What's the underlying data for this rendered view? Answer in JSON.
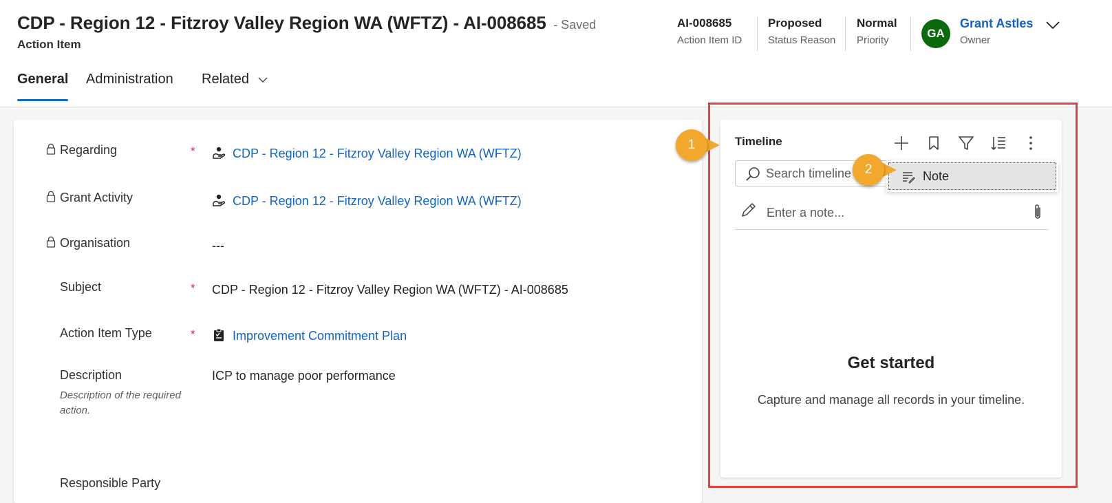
{
  "header": {
    "title": "CDP - Region 12 - Fitzroy Valley Region WA (WFTZ) - AI-008685",
    "save_status": "- Saved",
    "entity": "Action Item",
    "fields": [
      {
        "value": "AI-008685",
        "label": "Action Item ID"
      },
      {
        "value": "Proposed",
        "label": "Status Reason"
      },
      {
        "value": "Normal",
        "label": "Priority"
      }
    ],
    "owner": {
      "initials": "GA",
      "name": "Grant Astles",
      "label": "Owner",
      "avatar_color": "#0b6a0b"
    }
  },
  "tabs": [
    {
      "label": "General",
      "active": true
    },
    {
      "label": "Administration",
      "active": false
    },
    {
      "label": "Related",
      "active": false
    }
  ],
  "form": {
    "regarding": {
      "label": "Regarding",
      "required": "*",
      "value": "CDP - Region 12 - Fitzroy Valley Region WA (WFTZ)"
    },
    "grant_activity": {
      "label": "Grant Activity",
      "value": "CDP - Region 12 - Fitzroy Valley Region WA (WFTZ)"
    },
    "organisation": {
      "label": "Organisation",
      "value": "---"
    },
    "subject": {
      "label": "Subject",
      "required": "*",
      "value": "CDP - Region 12 - Fitzroy Valley Region WA (WFTZ) - AI-008685"
    },
    "action_item_type": {
      "label": "Action Item Type",
      "required": "*",
      "value": "Improvement Commitment Plan"
    },
    "description": {
      "label": "Description",
      "hint": "Description of the required action.",
      "value": "ICP to manage poor performance"
    },
    "responsible_party": {
      "label": "Responsible Party"
    }
  },
  "timeline": {
    "title": "Timeline",
    "search_placeholder": "Search timeline",
    "menu_item": "Note",
    "note_placeholder": "Enter a note...",
    "empty_title": "Get started",
    "empty_desc": "Capture and manage all records in your timeline."
  },
  "annotations": {
    "step1": "1",
    "step2": "2",
    "callout_color": "#f2a72d",
    "highlight_color": "#e0433f"
  },
  "colors": {
    "link": "#1364c7",
    "accent": "#0f6cbd",
    "required": "#c4314b"
  }
}
